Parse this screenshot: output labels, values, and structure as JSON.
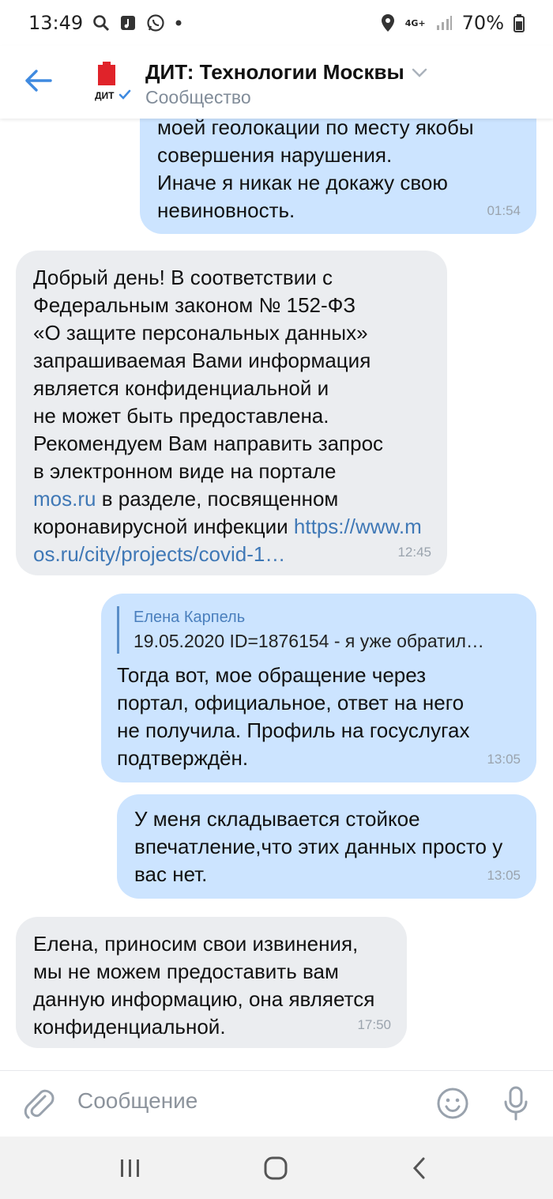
{
  "status_bar": {
    "time": "13:49",
    "network": "4G+",
    "battery": "70%",
    "icons": [
      "search-icon",
      "music-icon",
      "whatsapp-icon",
      "dot-icon",
      "location-icon",
      "signal-icon",
      "battery-icon"
    ]
  },
  "header": {
    "title": "ДИТ: Технологии Москвы",
    "subtitle": "Сообщество",
    "avatar_text": "ДИТ"
  },
  "messages": [
    {
      "direction": "out",
      "text": "моей геолокации по месту якобы\nсовершения нарушения.\nИначе я никак не докажу свою\nневиновность.",
      "time": "01:54"
    },
    {
      "direction": "in",
      "text_before_link": "Добрый день! В соответствии с\nФедеральным законом № 152-ФЗ\n«О защите персональных данных»\nзапрашиваемая Вами информация\nявляется конфиденциальной и\nне может быть предоставлена.\nРекомендуем Вам направить запрос\nв электронном виде на портале\n",
      "link1": "mos.ru",
      "text_middle": " в разделе, посвященном\nкоронавирусной инфекции ",
      "link2": "https://www.mos.ru/city/projects/covid-1…",
      "time": "12:45"
    },
    {
      "direction": "out",
      "reply_name": "Елена Карпель",
      "reply_text": "19.05.2020 ID=1876154 - я уже обратил…",
      "text": "Тогда вот, мое обращение через\nпортал, официальное, ответ на него\nне получила. Профиль на госуслугах\nподтверждён.",
      "time": "13:05"
    },
    {
      "direction": "out",
      "text": "У меня складывается стойкое\nвпечатление,что этих данных просто у\nвас нет.",
      "time": "13:05"
    },
    {
      "direction": "in",
      "text": "Елена, приносим свои извинения,\nмы не можем предоставить вам\nданную информацию, она является\nконфиденциальной.",
      "time": "17:50"
    }
  ],
  "composer": {
    "placeholder": "Сообщение"
  },
  "colors": {
    "accent": "#3f8ae0",
    "outgoing_bubble": "#cce4ff",
    "incoming_bubble": "#ebedf0",
    "link": "#3f78b6"
  }
}
